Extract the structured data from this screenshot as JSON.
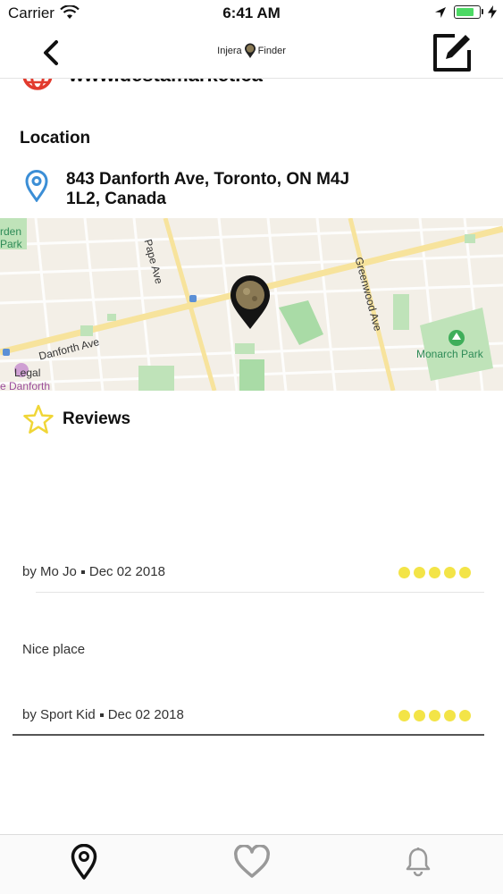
{
  "status_bar": {
    "carrier": "Carrier",
    "time": "6:41 AM",
    "battery_level": 0.8
  },
  "nav": {
    "title_left": "Injera",
    "title_right": "Finder"
  },
  "website": {
    "text": "www.destamarket.ca"
  },
  "location": {
    "title": "Location",
    "address_line1": "843 Danforth Ave, Toronto, ON M4J",
    "address_line2": "1L2, Canada"
  },
  "map": {
    "labels": {
      "park_top_left_1": "rden",
      "park_top_left_2": "Park",
      "cross_street": "Pape Ave",
      "main_street": "Danforth Ave",
      "side_street": "Greenwood Ave",
      "park_right": "Monarch Park",
      "legal": "Legal",
      "danforth_bottom": "e Danforth"
    }
  },
  "reviews": {
    "title": "Reviews",
    "items": [
      {
        "author": "by Mo Jo",
        "date": "Dec 02 2018",
        "text": "",
        "rating": 5
      },
      {
        "author": "by Sport Kid",
        "date": "Dec 02 2018",
        "text": "Nice place",
        "rating": 5
      }
    ]
  },
  "colors": {
    "accent_red": "#e23b2e",
    "pin_blue": "#3b8ed6",
    "star_yellow": "#f3e447",
    "map_green": "#9fd4a3"
  },
  "tabs": [
    {
      "icon": "map-pin-icon",
      "active": true
    },
    {
      "icon": "heart-icon",
      "active": false
    },
    {
      "icon": "bell-icon",
      "active": false
    }
  ]
}
